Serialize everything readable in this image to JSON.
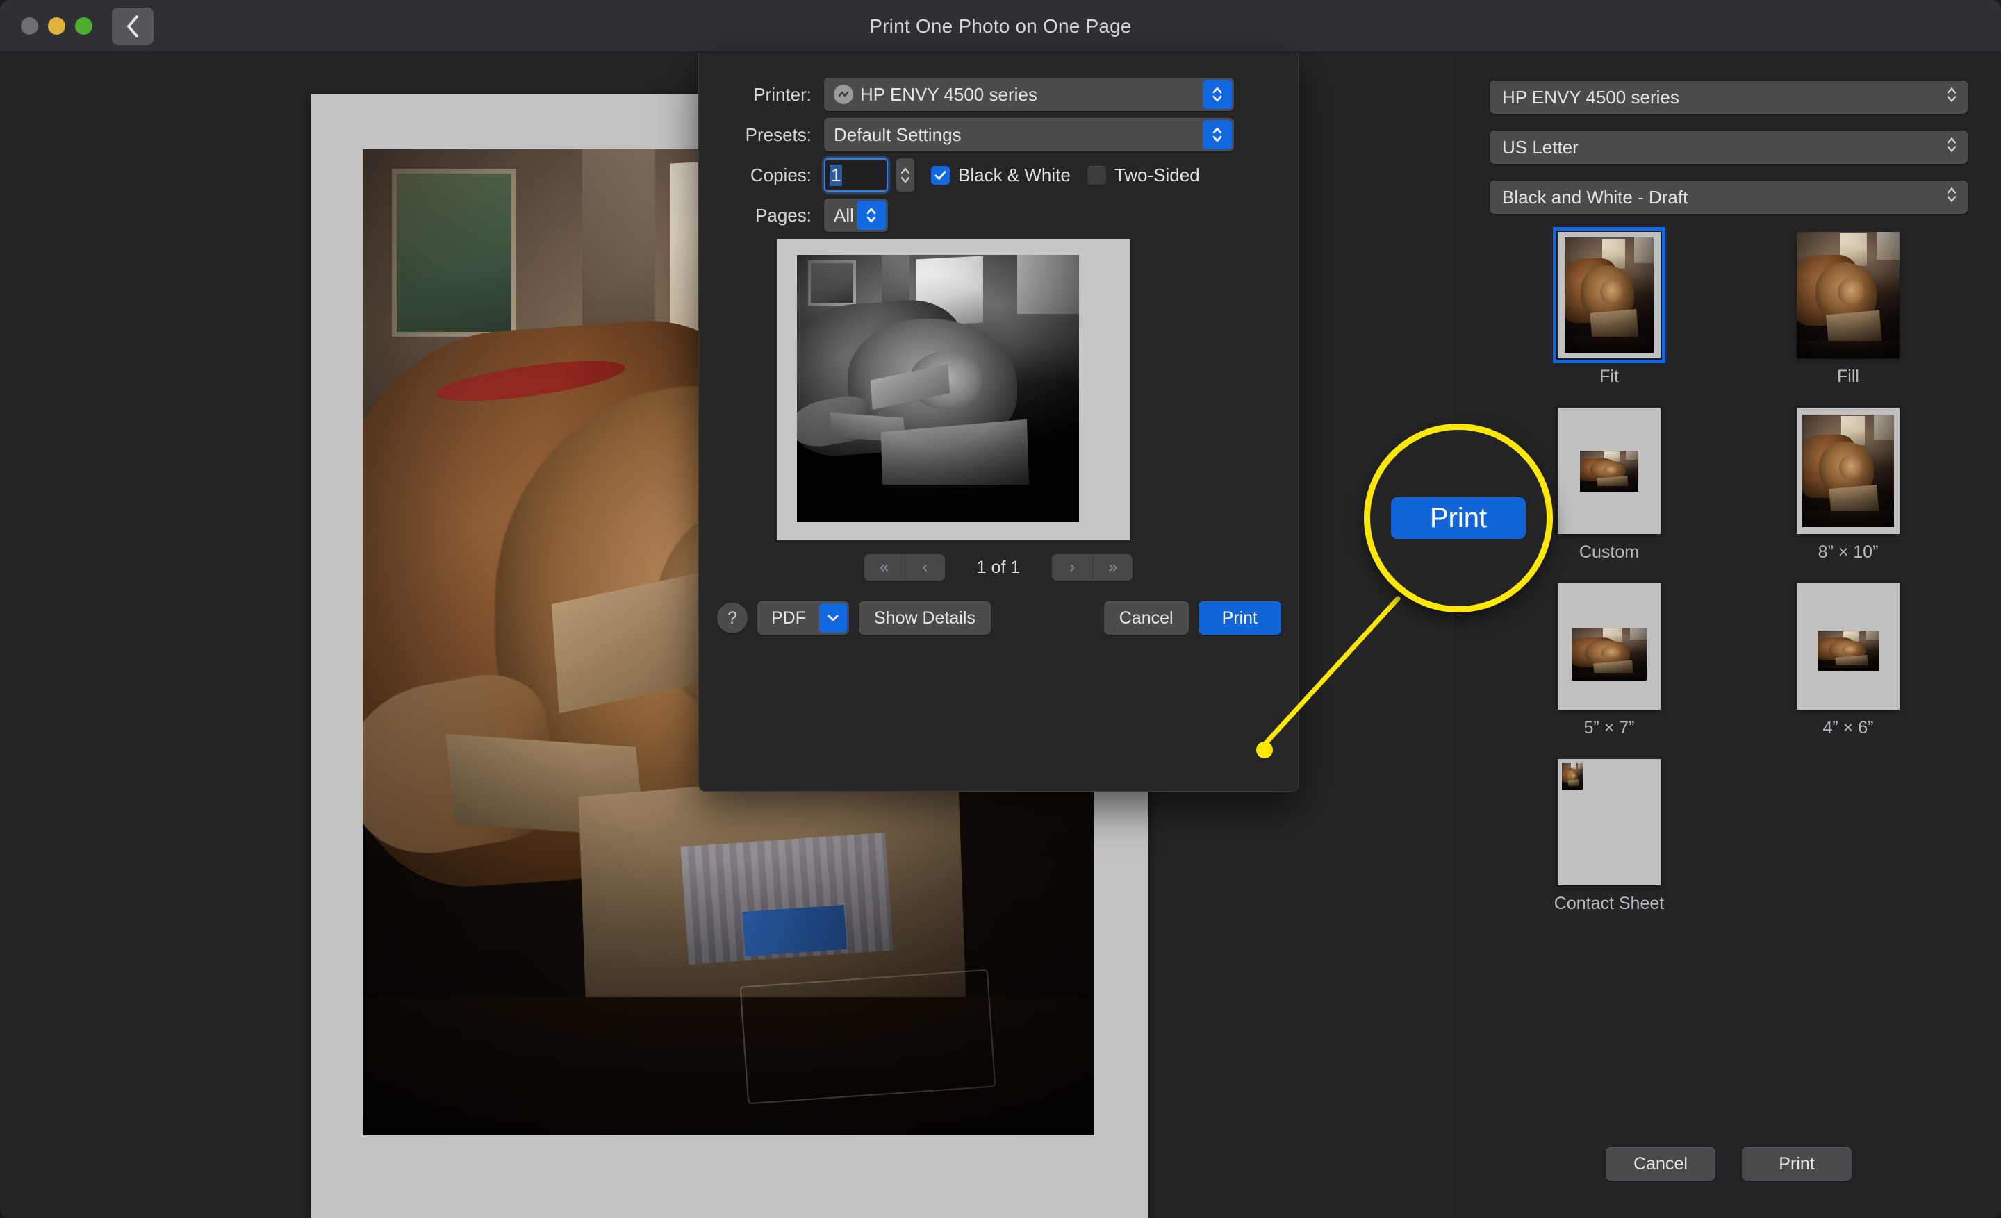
{
  "window": {
    "title": "Print One Photo on One Page",
    "traffic_lights": [
      "close",
      "minimize",
      "zoom"
    ],
    "back_icon": "chevron-left-icon"
  },
  "dialog": {
    "printer": {
      "label": "Printer:",
      "value": "HP ENVY 4500 series",
      "status_icon": "printer-status-icon"
    },
    "presets": {
      "label": "Presets:",
      "value": "Default Settings"
    },
    "copies": {
      "label": "Copies:",
      "value": "1"
    },
    "black_and_white": {
      "label": "Black & White",
      "checked": true
    },
    "two_sided": {
      "label": "Two-Sided",
      "checked": false
    },
    "pages": {
      "label": "Pages:",
      "value": "All"
    },
    "page_nav": {
      "first": "«",
      "prev": "‹",
      "indicator": "1 of 1",
      "next": "›",
      "last": "»"
    },
    "buttons": {
      "help": "?",
      "pdf": "PDF",
      "show_details": "Show Details",
      "cancel": "Cancel",
      "print": "Print"
    }
  },
  "sidebar": {
    "printer_select": "HP ENVY 4500 series",
    "paper_size_select": "US Letter",
    "quality_select": "Black and White - Draft",
    "presets": [
      {
        "label": "Fit",
        "selected": true,
        "crop": "t-fit"
      },
      {
        "label": "Fill",
        "selected": false,
        "crop": "t-fill"
      },
      {
        "label": "Custom",
        "selected": false,
        "crop": "t-custom"
      },
      {
        "label": "8” × 10”",
        "selected": false,
        "crop": "t-8x10"
      },
      {
        "label": "5” × 7”",
        "selected": false,
        "crop": "t-5x7"
      },
      {
        "label": "4” × 6”",
        "selected": false,
        "crop": "t-4x6"
      },
      {
        "label": "Contact Sheet",
        "selected": false,
        "crop": "t-contact"
      }
    ],
    "buttons": {
      "cancel": "Cancel",
      "print": "Print"
    }
  },
  "annotation": {
    "magnified_label": "Print",
    "circle_color": "#ffe800",
    "pointer_color": "#ffe800"
  },
  "colors": {
    "accent_blue": "#1163d8",
    "highlight_yellow": "#ffe800",
    "window_bg": "#242427",
    "dialog_bg": "#262628",
    "control_bg": "#4b4b4e"
  }
}
